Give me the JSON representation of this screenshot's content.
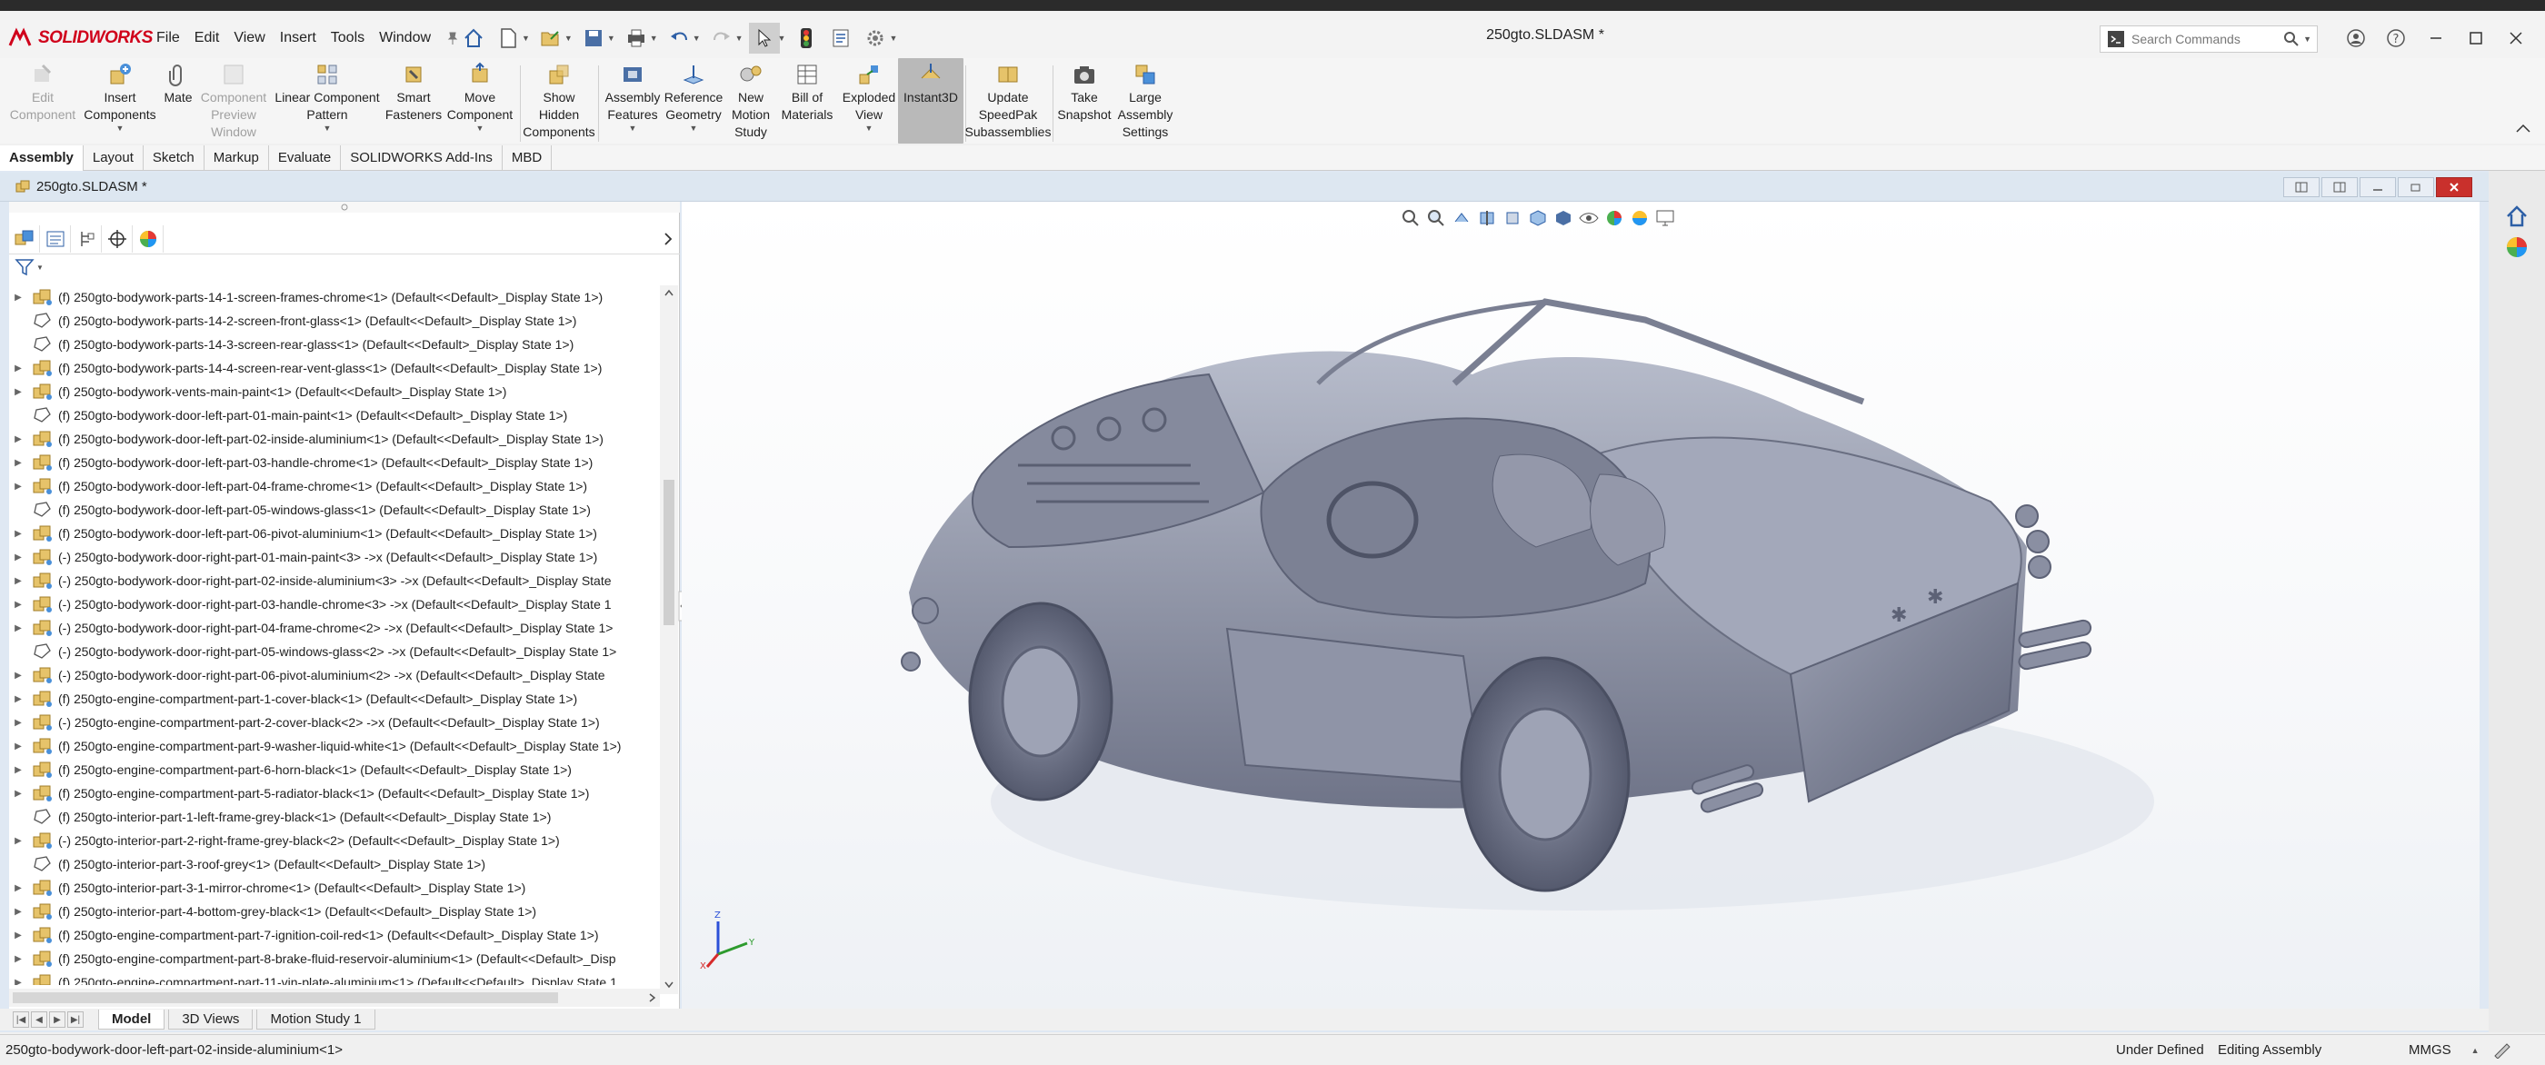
{
  "app": {
    "brand": "SOLIDWORKS",
    "document_title": "250gto.SLDASM *",
    "accent_color": "#d0021b"
  },
  "menu": [
    "File",
    "Edit",
    "View",
    "Insert",
    "Tools",
    "Window"
  ],
  "search": {
    "placeholder": "Search Commands"
  },
  "ribbon": {
    "edit_component": "Edit Component",
    "insert_components": "Insert Components",
    "mate": "Mate",
    "component_preview": "Component Preview Window",
    "linear_pattern": "Linear Component Pattern",
    "smart_fasteners": "Smart Fasteners",
    "move_component": "Move Component",
    "show_hidden": "Show Hidden Components",
    "assembly_features": "Assembly Features",
    "reference_geometry": "Reference Geometry",
    "new_motion_study": "New Motion Study",
    "bill_of_materials": "Bill of Materials",
    "exploded_view": "Exploded View",
    "instant3d": "Instant3D",
    "update_speedpak": "Update SpeedPak Subassemblies",
    "take_snapshot": "Take Snapshot",
    "large_assembly": "Large Assembly Settings"
  },
  "cm_tabs": [
    "Assembly",
    "Layout",
    "Sketch",
    "Markup",
    "Evaluate",
    "SOLIDWORKS Add-Ins",
    "MBD"
  ],
  "document": {
    "title": "250gto.SLDASM *"
  },
  "tree": [
    {
      "label": "(f) 250gto-bodywork-parts-14-1-screen-frames-chrome<1> (Default<<Default>_Display State 1>)",
      "assembly": true
    },
    {
      "label": "(f) 250gto-bodywork-parts-14-2-screen-front-glass<1> (Default<<Default>_Display State 1>)",
      "assembly": false
    },
    {
      "label": "(f) 250gto-bodywork-parts-14-3-screen-rear-glass<1> (Default<<Default>_Display State 1>)",
      "assembly": false
    },
    {
      "label": "(f) 250gto-bodywork-parts-14-4-screen-rear-vent-glass<1> (Default<<Default>_Display State 1>)",
      "assembly": true
    },
    {
      "label": "(f) 250gto-bodywork-vents-main-paint<1> (Default<<Default>_Display State 1>)",
      "assembly": true
    },
    {
      "label": "(f) 250gto-bodywork-door-left-part-01-main-paint<1> (Default<<Default>_Display State 1>)",
      "assembly": false
    },
    {
      "label": "(f) 250gto-bodywork-door-left-part-02-inside-aluminium<1> (Default<<Default>_Display State 1>)",
      "assembly": true
    },
    {
      "label": "(f) 250gto-bodywork-door-left-part-03-handle-chrome<1> (Default<<Default>_Display State 1>)",
      "assembly": true
    },
    {
      "label": "(f) 250gto-bodywork-door-left-part-04-frame-chrome<1> (Default<<Default>_Display State 1>)",
      "assembly": true
    },
    {
      "label": "(f) 250gto-bodywork-door-left-part-05-windows-glass<1> (Default<<Default>_Display State 1>)",
      "assembly": false
    },
    {
      "label": "(f) 250gto-bodywork-door-left-part-06-pivot-aluminium<1> (Default<<Default>_Display State 1>)",
      "assembly": true
    },
    {
      "label": "(-) 250gto-bodywork-door-right-part-01-main-paint<3> ->x (Default<<Default>_Display State 1>)",
      "assembly": true
    },
    {
      "label": "(-) 250gto-bodywork-door-right-part-02-inside-aluminium<3> ->x (Default<<Default>_Display State",
      "assembly": true
    },
    {
      "label": "(-) 250gto-bodywork-door-right-part-03-handle-chrome<3> ->x (Default<<Default>_Display State 1",
      "assembly": true
    },
    {
      "label": "(-) 250gto-bodywork-door-right-part-04-frame-chrome<2> ->x (Default<<Default>_Display State 1>",
      "assembly": true
    },
    {
      "label": "(-) 250gto-bodywork-door-right-part-05-windows-glass<2> ->x (Default<<Default>_Display State 1>",
      "assembly": false
    },
    {
      "label": "(-) 250gto-bodywork-door-right-part-06-pivot-aluminium<2> ->x (Default<<Default>_Display State",
      "assembly": true
    },
    {
      "label": "(f) 250gto-engine-compartment-part-1-cover-black<1> (Default<<Default>_Display State 1>)",
      "assembly": true
    },
    {
      "label": "(-) 250gto-engine-compartment-part-2-cover-black<2> ->x (Default<<Default>_Display State 1>)",
      "assembly": true
    },
    {
      "label": "(f) 250gto-engine-compartment-part-9-washer-liquid-white<1> (Default<<Default>_Display State 1>)",
      "assembly": true
    },
    {
      "label": "(f) 250gto-engine-compartment-part-6-horn-black<1> (Default<<Default>_Display State 1>)",
      "assembly": true
    },
    {
      "label": "(f) 250gto-engine-compartment-part-5-radiator-black<1> (Default<<Default>_Display State 1>)",
      "assembly": true
    },
    {
      "label": "(f) 250gto-interior-part-1-left-frame-grey-black<1> (Default<<Default>_Display State 1>)",
      "assembly": false
    },
    {
      "label": "(-) 250gto-interior-part-2-right-frame-grey-black<2> (Default<<Default>_Display State 1>)",
      "assembly": true
    },
    {
      "label": "(f) 250gto-interior-part-3-roof-grey<1> (Default<<Default>_Display State 1>)",
      "assembly": false
    },
    {
      "label": "(f) 250gto-interior-part-3-1-mirror-chrome<1> (Default<<Default>_Display State 1>)",
      "assembly": true
    },
    {
      "label": "(f) 250gto-interior-part-4-bottom-grey-black<1> (Default<<Default>_Display State 1>)",
      "assembly": true
    },
    {
      "label": "(f) 250gto-engine-compartment-part-7-ignition-coil-red<1> (Default<<Default>_Display State 1>)",
      "assembly": true
    },
    {
      "label": "(f) 250gto-engine-compartment-part-8-brake-fluid-reservoir-aluminium<1> (Default<<Default>_Disp",
      "assembly": true
    },
    {
      "label": "(f) 250gto-engine-compartment-part-11-vin-plate-aluminium<1> (Default<<Default>_Display State 1",
      "assembly": true
    }
  ],
  "bottom_tabs": [
    "Model",
    "3D Views",
    "Motion Study 1"
  ],
  "triad": {
    "x": "X",
    "y": "Y",
    "z": "Z"
  },
  "status": {
    "selection": "250gto-bodywork-door-left-part-02-inside-aluminium<1>",
    "state": "Under Defined",
    "mode": "Editing Assembly",
    "units": "MMGS"
  }
}
